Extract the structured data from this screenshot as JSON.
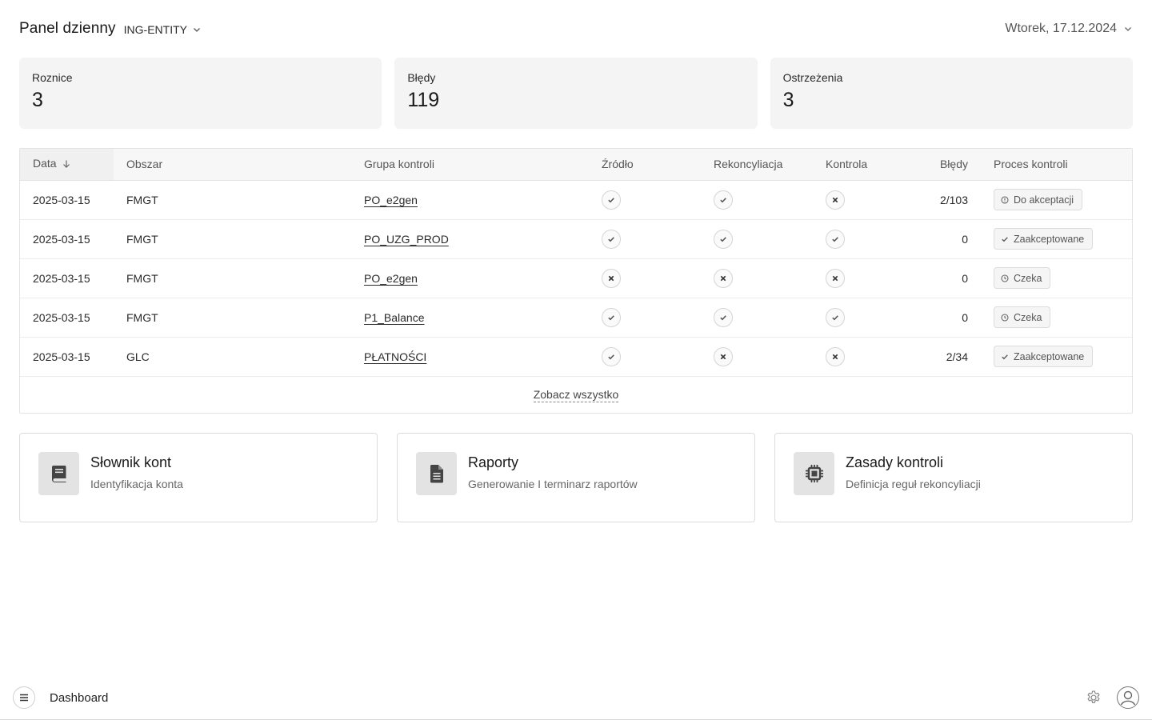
{
  "header": {
    "title": "Panel dzienny",
    "entity": "ING-ENTITY",
    "date": "Wtorek, 17.12.2024"
  },
  "stats": [
    {
      "label": "Roznice",
      "value": "3"
    },
    {
      "label": "Błędy",
      "value": "119"
    },
    {
      "label": "Ostrzeżenia",
      "value": "3"
    }
  ],
  "table": {
    "columns": {
      "data": "Data",
      "obszar": "Obszar",
      "grupa": "Grupa kontroli",
      "zrodlo": "Źródło",
      "rekoncyliacja": "Rekoncyliacja",
      "kontrola": "Kontrola",
      "bledy": "Błędy",
      "proces": "Proces kontroli"
    },
    "rows": [
      {
        "data": "2025-03-15",
        "obszar": "FMGT",
        "grupa": "PO_e2gen",
        "zrodlo": "ok",
        "rekoncyliacja": "ok",
        "kontrola": "fail",
        "bledy": "2/103",
        "proces": "Do akceptacji",
        "proces_icon": "clock-alert-icon"
      },
      {
        "data": "2025-03-15",
        "obszar": "FMGT",
        "grupa": "PO_UZG_PROD",
        "zrodlo": "ok",
        "rekoncyliacja": "ok",
        "kontrola": "ok",
        "bledy": "0",
        "proces": "Zaakceptowane",
        "proces_icon": "check-icon"
      },
      {
        "data": "2025-03-15",
        "obszar": "FMGT",
        "grupa": "PO_e2gen",
        "zrodlo": "fail",
        "rekoncyliacja": "fail",
        "kontrola": "fail",
        "bledy": "0",
        "proces": "Czeka",
        "proces_icon": "clock-icon"
      },
      {
        "data": "2025-03-15",
        "obszar": "FMGT",
        "grupa": "P1_Balance",
        "zrodlo": "ok",
        "rekoncyliacja": "ok",
        "kontrola": "ok",
        "bledy": "0",
        "proces": "Czeka",
        "proces_icon": "clock-icon"
      },
      {
        "data": "2025-03-15",
        "obszar": "GLC",
        "grupa": "PŁATNOŚCI",
        "zrodlo": "ok",
        "rekoncyliacja": "fail",
        "kontrola": "fail",
        "bledy": "2/34",
        "proces": "Zaakceptowane",
        "proces_icon": "check-icon"
      }
    ],
    "see_all": "Zobacz wszystko"
  },
  "features": [
    {
      "title": "Słownik kont",
      "subtitle": "Identyfikacja konta",
      "icon": "book-icon"
    },
    {
      "title": "Raporty",
      "subtitle": "Generowanie I terminarz raportów",
      "icon": "document-icon"
    },
    {
      "title": "Zasady kontroli",
      "subtitle": "Definicja reguł rekoncyliacji",
      "icon": "chip-icon"
    }
  ],
  "bottom": {
    "title": "Dashboard"
  },
  "colors": {
    "card_bg": "#f4f4f4",
    "border": "#e3e3e3",
    "text": "#1f1f1f"
  }
}
